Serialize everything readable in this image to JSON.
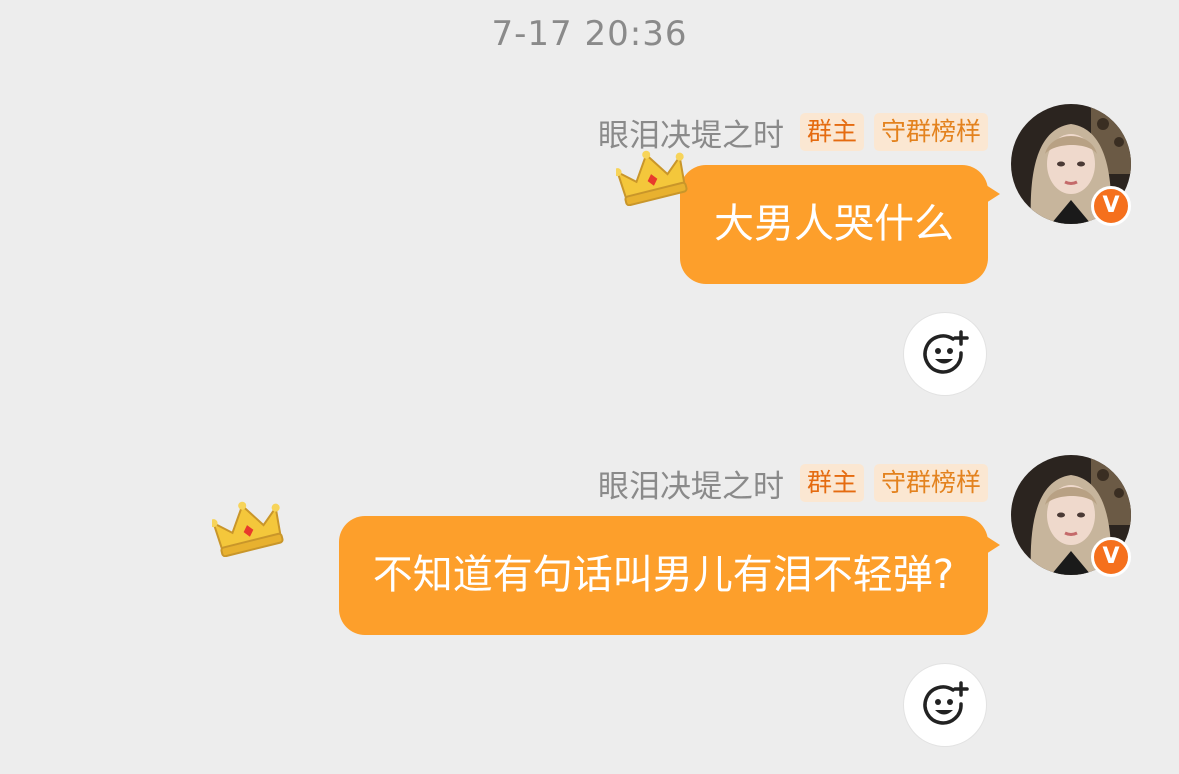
{
  "timestamp": "7-17 20:36",
  "messages": [
    {
      "sender": "眼泪决堤之时",
      "badges": [
        "群主",
        "守群榜样"
      ],
      "text": "大男人哭什么",
      "avatar_badge": "V"
    },
    {
      "sender": "眼泪决堤之时",
      "badges": [
        "群主",
        "守群榜样"
      ],
      "text": "不知道有句话叫男儿有泪不轻弹?",
      "avatar_badge": "V"
    }
  ],
  "icons": {
    "crown": "crown-icon",
    "reaction": "add-reaction-icon",
    "verified": "verified-v-icon"
  },
  "colors": {
    "background": "#ededed",
    "bubble": "#fd9f2b",
    "bubble_text": "#ffffff",
    "badge_bg": "#fbe7d2",
    "badge_owner_text": "#e56b10",
    "badge_role_text": "#e3821e",
    "verified_badge": "#f5701d"
  }
}
